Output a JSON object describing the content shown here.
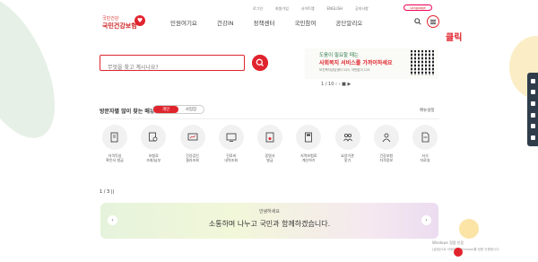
{
  "header": {
    "logo_small": "국민건강",
    "logo_text": "국민건강보험",
    "nav": [
      "민원여기요",
      "건강iN",
      "정책센터",
      "국민참여",
      "공단알리오"
    ],
    "utility": [
      "로그인",
      "회원가입",
      "사이트맵",
      "ENGLISH",
      "공지사항"
    ],
    "language": "Language",
    "annotation": "클릭"
  },
  "search": {
    "placeholder": "무엇을 찾고 계시나요?"
  },
  "banner": {
    "line1": "도움이 필요할 때는",
    "line2": "사회복지 서비스를 가까이하세요",
    "line3": "보건복지상담센터 129, 국번없이 129",
    "pager": "1 / 10  ‹  ›  ■  ▶"
  },
  "popular": {
    "title": "방문자별 많이 찾는 메뉴",
    "tabs": [
      "개인",
      "사업장"
    ],
    "setting": "메뉴설정"
  },
  "icons": [
    {
      "icon": "document-icon",
      "label1": "자격득실",
      "label2": "확인서 발급"
    },
    {
      "icon": "search-doc-icon",
      "label1": "보험료",
      "label2": "조회/납부"
    },
    {
      "icon": "screen-icon",
      "label1": "건강검진",
      "label2": "결과조회"
    },
    {
      "icon": "monitor-icon",
      "label1": "진료비",
      "label2": "내역조회"
    },
    {
      "icon": "certificate-icon",
      "label1": "증명서",
      "label2": "발급"
    },
    {
      "icon": "calculator-icon",
      "label1": "지역보험료",
      "label2": "계산하기"
    },
    {
      "icon": "people-icon",
      "label1": "요양기관",
      "label2": "찾기"
    },
    {
      "icon": "person-icon",
      "label1": "건강보험",
      "label2": "자격정보"
    },
    {
      "icon": "paper-icon",
      "label1": "서식",
      "label2": "자료실"
    }
  ],
  "page2": "1 / 3  ||",
  "slogan": {
    "small": "안녕하세요",
    "main": "소통하며 나누고 국민과 함께하겠습니다."
  },
  "windows": {
    "line1": "Windows 정품 인증",
    "line2": "[설정]으로 이동하여 Windows를 정품 인증합니다."
  },
  "colors": {
    "accent": "#e0242d",
    "side": "#2f3d4b"
  }
}
